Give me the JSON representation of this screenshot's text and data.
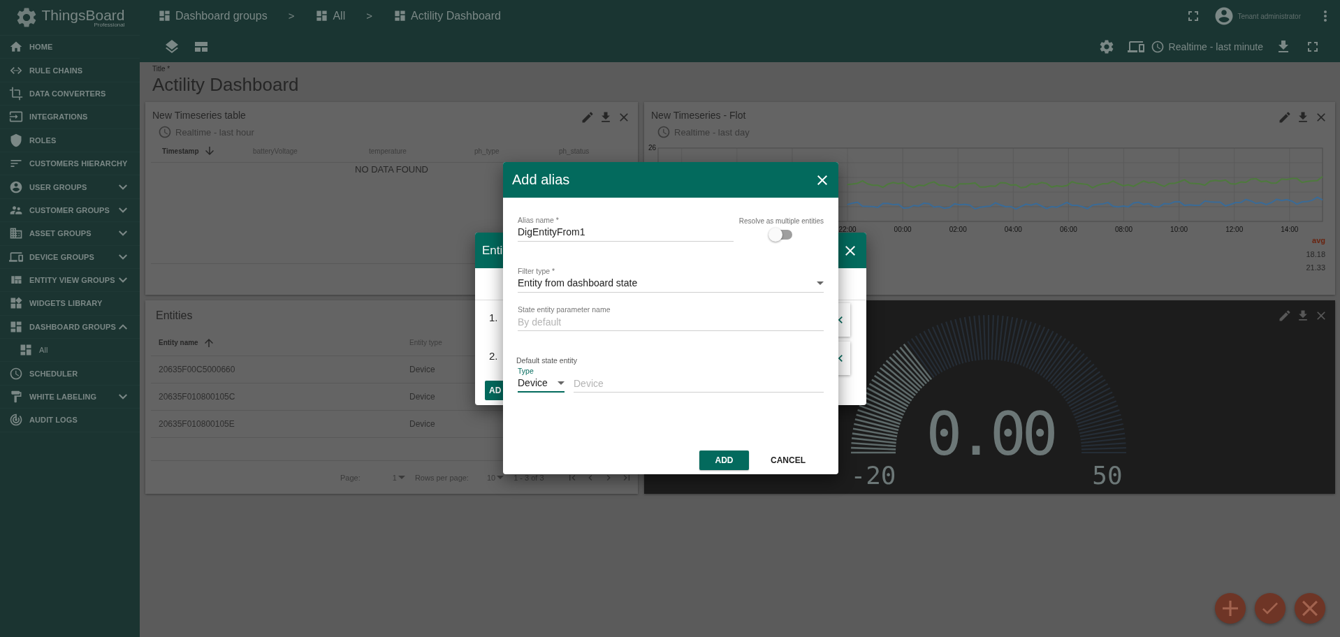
{
  "sidebar": {
    "logo": {
      "name": "ThingsBoard",
      "edition": "Professional"
    },
    "items": [
      {
        "label": "HOME",
        "kind": "link"
      },
      {
        "label": "RULE CHAINS",
        "kind": "link"
      },
      {
        "label": "DATA CONVERTERS",
        "kind": "link"
      },
      {
        "label": "INTEGRATIONS",
        "kind": "link"
      },
      {
        "label": "ROLES",
        "kind": "link"
      },
      {
        "label": "CUSTOMERS HIERARCHY",
        "kind": "link"
      },
      {
        "label": "USER GROUPS",
        "kind": "group",
        "expanded": false
      },
      {
        "label": "CUSTOMER GROUPS",
        "kind": "group",
        "expanded": false
      },
      {
        "label": "ASSET GROUPS",
        "kind": "group",
        "expanded": false
      },
      {
        "label": "DEVICE GROUPS",
        "kind": "group",
        "expanded": false
      },
      {
        "label": "ENTITY VIEW GROUPS",
        "kind": "group",
        "expanded": false
      },
      {
        "label": "WIDGETS LIBRARY",
        "kind": "link"
      },
      {
        "label": "DASHBOARD GROUPS",
        "kind": "group",
        "expanded": true,
        "children": [
          {
            "label": "All"
          }
        ]
      },
      {
        "label": "SCHEDULER",
        "kind": "link"
      },
      {
        "label": "WHITE LABELING",
        "kind": "group",
        "expanded": false
      },
      {
        "label": "AUDIT LOGS",
        "kind": "link"
      }
    ]
  },
  "toolbar": {
    "breadcrumbs": [
      {
        "label": "Dashboard groups",
        "separator": ">"
      },
      {
        "label": "All",
        "separator": ">"
      },
      {
        "label": "Actility Dashboard"
      }
    ],
    "user": {
      "role": "Tenant administrator"
    },
    "timewindow": "Realtime - last minute"
  },
  "dashboard_title": {
    "label": "Title *",
    "value": "Actility Dashboard"
  },
  "widgets": [
    {
      "kind": "timeseries_table",
      "title": "New Timeseries table",
      "timewindow": "Realtime - last hour",
      "columns": [
        {
          "label": "Timestamp",
          "sorted": true,
          "descending": true
        },
        {
          "label": "batteryVoltage",
          "sorted": false
        },
        {
          "label": "temperature",
          "sorted": false
        },
        {
          "label": "ph_type",
          "sorted": false
        },
        {
          "label": "ph_status",
          "sorted": false
        }
      ],
      "empty_text": "NO DATA FOUND"
    },
    {
      "kind": "flot",
      "title": "New Timeseries - Flot",
      "timewindow": "Realtime - last day",
      "y_tick": "26",
      "x_ticks": [
        "22:00",
        "00:00",
        "02:00",
        "04:00",
        "06:00",
        "08:00",
        "10:00",
        "12:00",
        "14:00"
      ],
      "legend": {
        "header": "avg",
        "values": [
          "18.18",
          "21.33"
        ]
      }
    },
    {
      "kind": "entities",
      "title": "Entities",
      "columns": [
        {
          "label": "Entity name",
          "sorted": true,
          "descending": false
        },
        {
          "label": "Entity type",
          "sorted": false
        }
      ],
      "rows": [
        {
          "name": "20635F00C5000660",
          "type": "Device"
        },
        {
          "name": "20635F010800105C",
          "type": "Device"
        },
        {
          "name": "20635F010800105E",
          "type": "Device"
        }
      ],
      "paginator": {
        "page_label": "Page:",
        "page": "1",
        "rows_label": "Rows per page:",
        "rows": "10",
        "range": "1 - 3 of 3"
      }
    },
    {
      "kind": "gauge",
      "value": "0.00",
      "min": "-20",
      "max": "50",
      "level": 0.29
    }
  ],
  "entity_aliases_dialog": {
    "title": "Enti",
    "rows": [
      {
        "index": "1."
      },
      {
        "index": "2."
      }
    ],
    "add_button": "AD"
  },
  "add_alias": {
    "title": "Add alias",
    "alias_name": {
      "label": "Alias name *",
      "value": "DigEntityFrom1"
    },
    "resolve_multiple": {
      "label": "Resolve as multiple entities",
      "on": false
    },
    "filter_type": {
      "label": "Filter type *",
      "value": "Entity from dashboard state"
    },
    "state_param": {
      "label": "State entity parameter name",
      "placeholder": "By default"
    },
    "default_entity": {
      "label": "Default state entity",
      "type": {
        "label": "Type",
        "value": "Device",
        "focused": true
      },
      "entity": {
        "placeholder": "Device"
      }
    },
    "buttons": [
      {
        "label": "ADD",
        "kind": "primary"
      },
      {
        "label": "CANCEL",
        "kind": "flat"
      }
    ]
  }
}
